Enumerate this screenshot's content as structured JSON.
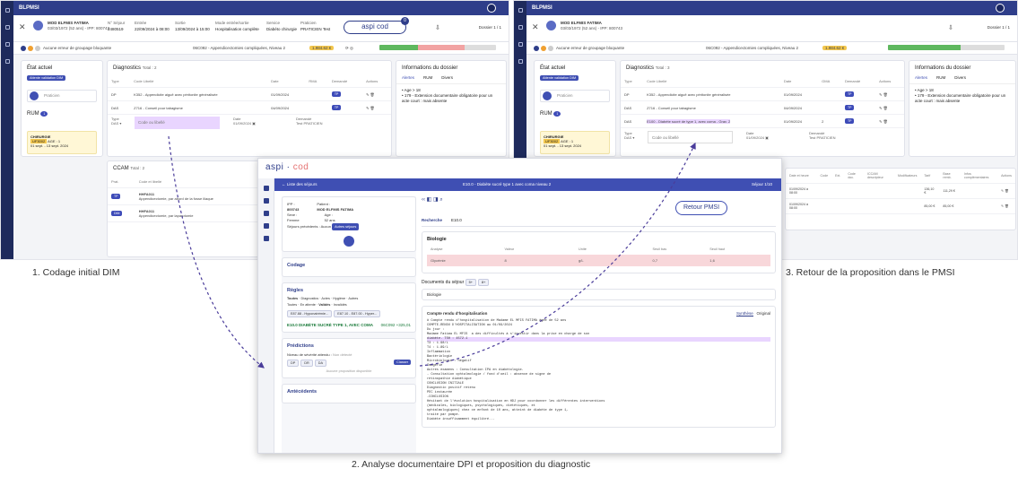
{
  "pmsi_left": {
    "app_title": "BLPMSI",
    "patient_name": "MOD ELFMIS FATIMA",
    "patient_sub": "03/03/1972 (52 ans) - IPP: 800743",
    "cols": [
      [
        "N° Séjour",
        "2480519"
      ],
      [
        "Entrée",
        "22/09/2024 à 08:00"
      ],
      [
        "Sortie",
        "13/09/2024 à 15:00"
      ],
      [
        "Mode entrée/sortie",
        "Hospitalisation complète"
      ],
      [
        "Service",
        "Diabéto chirurgie"
      ],
      [
        "Praticien",
        "PRATICIEN Test"
      ]
    ],
    "aspi_label": "aspi cod",
    "aspi_badge": "0",
    "dossier": "Dossier 1 / 1",
    "alert": "Aucune erreur de groupage bloquante",
    "ghm": "06C092 - Appendicectomies compliquées, Niveau 2",
    "ghm_badge": "1.984.62 €",
    "etat_title": "État actuel",
    "etat_badge": "Attente validation DIM",
    "praticien": "Praticien",
    "rum_title": "RUM",
    "rum_badge": "1",
    "rum_service": "CHIRURGIE",
    "rum_uf": "UF3002",
    "rum_age": "AGE : 1",
    "rum_dates": "01 sept. - 13 sept. 2024",
    "diag_title": "Diagnostics",
    "diag_total": "Total : 2",
    "diag_headers": [
      "Type",
      "Code Libellé",
      "Date",
      "RMA",
      "Demandé",
      "Actions"
    ],
    "diag_rows": [
      [
        "DP",
        "K352 - Appendicite aiguë avec péritonite généralisée",
        "01/09/2024",
        "TP"
      ],
      [
        "DAS",
        "Z716 - Conseil pour tabagisme",
        "04/09/2024",
        "TP"
      ]
    ],
    "type_label": "Type",
    "type_val": "DAS",
    "code_placeholder": "Code ou libellé",
    "date_label": "Date",
    "date_val": "01/09/2024",
    "demandeur_label": "Demandé",
    "demandeur_val": "Test PRATICIEN",
    "info_title": "Informations du dossier",
    "info_tabs": [
      "Alertes",
      "RUM",
      "Divers"
    ],
    "info_items": [
      "• Age > 18",
      "• 179 - Extension documentaire obligatoire pour un acte court : mais absente"
    ],
    "ccam_title": "CCAM",
    "ccam_total": "Total : 2",
    "ccam_headers": [
      "Prat.",
      "Code et libellé"
    ],
    "ccam_rows": [
      [
        "TP",
        "HHFA011",
        "Appendicectomie, par abord de la fosse iliaque"
      ],
      [
        "DIM",
        "HHFA011",
        "Appendicectomie, par laparotomie"
      ]
    ]
  },
  "pmsi_right": {
    "app_title": "BLPMSI",
    "patient_name": "MOD ELFMIS FATIMA",
    "patient_sub": "03/03/1972 (52 ans) - IPP: 800743",
    "dossier": "Dossier 1 / 1",
    "alert": "Aucune erreur de groupage bloquante",
    "ghm": "06C092 - Appendicectomies compliquées, Niveau 2",
    "ghm_badge": "1.984.62 €",
    "diag_total": "Total : 3",
    "diag_rows": [
      [
        "DP",
        "K352 - Appendicite aiguë avec péritonite généralisée",
        "01/09/2024",
        "",
        "TP"
      ],
      [
        "DAS",
        "Z716 - Conseil pour tabagisme",
        "04/09/2024",
        "",
        "TP"
      ],
      [
        "DAS",
        "E100 - Diabète sucré de type 1, avec coma - Grav. 2",
        "01/09/2024",
        "2",
        "TP"
      ]
    ],
    "headers": [
      "Type",
      "Code Libellé",
      "Date",
      "GMA",
      "Demandé",
      "Actions"
    ],
    "ccam_headers": [
      "Date et heure",
      "Code",
      "Ext.",
      "Code doc.",
      "ICCAM descripteur",
      "Modificateurs",
      "Tarif",
      "Base remb.",
      "Infos complémentaires",
      "Actions"
    ],
    "ccam_rows": [
      [
        "01/09/2024 à 08:00",
        "",
        "",
        "",
        "",
        "",
        "136,10 €",
        "111,29 €"
      ],
      [
        "01/09/2024 à 08:00",
        "",
        "",
        "",
        "",
        "",
        "85,00 €",
        "85,00 €"
      ]
    ]
  },
  "dpi": {
    "brand": "aspi",
    "brand2": "cod",
    "header_left": "← Liste des séjours",
    "header_center": "E10.0 - Diabète sucré type 1 avec coma niveau 2",
    "header_right": "Séjour 1/10",
    "ipp_label": "IPP :",
    "ipp_val": "800743",
    "patient_label": "Patient :",
    "patient_val": "MOD ELFMIS FATIMA",
    "sexe_label": "Sexe :",
    "sexe_val": "Femme",
    "age_label": "Age :",
    "age_val": "52 ans",
    "sejours_label": "Séjours précédents",
    "sejours_val": "Aucun",
    "autres_btn": "Autres séjours",
    "codage": "Codage",
    "regles": "Règles",
    "regles_tabs": [
      "Toutes",
      "Diagnostics",
      "Actes",
      "Hygiène",
      "Autres"
    ],
    "regles_sub": [
      "Toutes",
      "En attente",
      "Validés",
      "Invalidés"
    ],
    "chips": [
      "E87.88 - Hyponatrémie...",
      "E87.10 - E87.00 - Hyper..."
    ],
    "proposal": "E10.0 DIABÈTE SUCRÉ TYPE 1, AVEC COMA",
    "proposal_code": "06C092 +325,01",
    "predictions": "Prédictions",
    "severite": "Niveau de sévérité attendu :",
    "severite_val": "Non détecté",
    "sev_chips": [
      "DP",
      "DR",
      "DA"
    ],
    "classer": "Classer",
    "pred_empty": "Aucune proposition disponible",
    "antecedents": "Antécédents",
    "retour": "Retour PMSI",
    "tabs": [
      "Recherche",
      "E10.0"
    ],
    "biologie": "Biologie",
    "bio_headers": [
      "Analyse",
      "Valeur",
      "Unité",
      "Seuil bas",
      "Seuil haut"
    ],
    "bio_row": [
      "Glycémie",
      "8",
      "g/L",
      "0,7",
      "1,6"
    ],
    "docs_title": "Documents du séjour",
    "docs_badges": [
      "5+",
      "8+"
    ],
    "bio_section": "Biologie",
    "cr_title": "Compte rendu d'hospitalisation",
    "cr_tabs": [
      "Synthèse",
      "Original"
    ],
    "cr_lines": [
      "# Compte rendu d'hospitalisation de Madame EL MFIS FATIMA âgée de 52 ans",
      "COMPTE-RENDU D'HOSPITALISATION au 01/09/2024",
      "Du jour :",
      "Madame Fatima EL MFIS  a des difficultés à s'investir dans la prise en charge de son",
      "diabète. TSH : 4572.1",
      "T3 : 1.98/L",
      "T4 : 1.89/L",
      "Inflammation",
      "Bactériologie",
      "Microbiologie : négatif",
      "Imagerie",
      "Autres examens : Consultation IPA en diabétologie.",
      "- Consultation ophtalmologie / fond d'oeil : absence de signe de",
      "rétinopathie diabétique",
      "CONCLUSION INITIALE",
      "Diagnostic positif retenu",
      "PEC instaurée",
      "-CONCLUSION",
      "Hésitant de l'évolution hospitalisation en HDJ pour coordonner les différentes interventions",
      "(médicales, biologiques, psychologiques, diététiques, et",
      "ophtalmologiques) chez ce enfant de 10 ans, atteint de diabète de type 1,",
      "traité par pompe.",
      "Diabète insuffisamment équilibré..."
    ]
  },
  "captions": {
    "c1": "1. Codage initial DIM",
    "c2": "2. Analyse documentaire DPI et proposition du diagnostic",
    "c3": "3. Retour de la proposition dans le PMSI"
  }
}
